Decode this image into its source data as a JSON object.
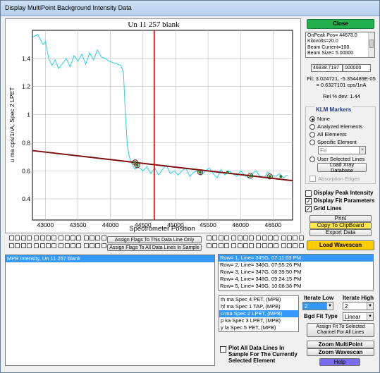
{
  "window": {
    "title": "Display MultiPoint Background Intensity Data"
  },
  "close_button": "Close",
  "info_text": [
    "OnPeak Pos= 44673.0",
    "Kilovolts=20.0",
    "Beam Current=100.",
    "Beam Size= 5.00000"
  ],
  "fields": {
    "value1": "46938.7197",
    "value2": "000000"
  },
  "fit_text": "Fit: 3.024721, -5.354489E-05 = 0.6327101 cps/1nA",
  "rel_dev": "Rel % dev: 1.44",
  "klm": {
    "title": "KLM Markers",
    "options": [
      "None",
      "Analyzed Elements",
      "All Elements",
      "Specific Element"
    ],
    "selected": 0,
    "element_value": "Fe",
    "user_lines": "User Selected Lines",
    "load_xray": "Load Xray Database",
    "absorption": "Absorption Edges"
  },
  "display_opts": [
    {
      "label": "Display Peak Intensity",
      "checked": false
    },
    {
      "label": "Display Fit Parameters",
      "checked": true
    },
    {
      "label": "Grid Lines",
      "checked": true
    }
  ],
  "buttons": {
    "print": "Print",
    "copy": "Copy To ClipBoard",
    "export": "Export Data",
    "load_wavescan": "Load Wavescan",
    "assign_flags_line": "Assign Flags To This Data Line Only",
    "assign_flags_all": "Assign Flags To All Data Lines In Sample",
    "assign_fit": "Assign Fit To Selected Channel For All Lines",
    "zoom_multipoint": "Zoom MultiPoint",
    "zoom_wavescan": "Zoom Wavescan",
    "help": "Help"
  },
  "mpb_list": [
    "MPB Intensity, Un   11  257 blank"
  ],
  "rows_list": [
    "Row= 1, Line=   345G, 07:11:03 PM",
    "Row= 2, Line=   346G, 07:55:26 PM",
    "Row= 3, Line=   347G, 08:39:50 PM",
    "Row= 4, Line=   348G, 09:24:15 PM",
    "Row= 5, Line=   349G, 10:08:38 PM"
  ],
  "spec_list": [
    "th ma Spec  4 PET, (MPB)",
    "hf ma Spec  1 TAP, (MPB)",
    " u ma Spec  2 LPET, (MPB)",
    " p ka Spec  3 LPET, (MPB)",
    " y la Spec  5 PET, (MPB)"
  ],
  "iterate": {
    "low_label": "Iterate Low",
    "high_label": "Iterate High",
    "low": "2",
    "high": "2"
  },
  "bgd_fit": {
    "label": "Bgd Fit Type",
    "value": "Linear"
  },
  "plot_all": "Plot All Data Lines In Sample For The Currently Selected Element",
  "chart_data": {
    "type": "line",
    "title": "Un   11  257 blank",
    "xlabel": "Spectrometer Position",
    "ylabel": "u ma cps/1nA, Spec  2 LPET",
    "xlim": [
      42800,
      46800
    ],
    "ylim": [
      0.25,
      1.6
    ],
    "xticks": [
      43000,
      43500,
      44000,
      44500,
      45000,
      45500,
      46000,
      46500
    ],
    "yticks": [
      0.4,
      0.6,
      0.8,
      1,
      1.2,
      1.4
    ],
    "onpeak_x": 44673,
    "fit_line": {
      "x": [
        42800,
        46800
      ],
      "y": [
        0.744,
        0.53
      ]
    },
    "wavescan_color": "#22d3e6",
    "wavescan": {
      "x": [
        42800,
        42880,
        42960,
        43000,
        43050,
        43100,
        43150,
        43200,
        43260,
        43320,
        43380,
        43440,
        43500,
        43560,
        43620,
        43680,
        43740,
        43800,
        43860,
        43920,
        43980,
        44040,
        44100,
        44160,
        44200,
        44230,
        44260,
        44290,
        44320,
        44350,
        44380,
        44410,
        44450,
        44500,
        44560,
        44620,
        44680,
        44740,
        44800,
        44860,
        44920,
        44980,
        45040,
        45100,
        45160,
        45220,
        45280,
        45340,
        45400,
        45460,
        45520,
        45580,
        45640,
        45700,
        45760,
        45820,
        45880,
        45940,
        46000,
        46060,
        46120,
        46180,
        46240,
        46300,
        46360,
        46420,
        46480,
        46540,
        46600,
        46660,
        46720
      ],
      "y": [
        1.55,
        1.57,
        1.5,
        1.52,
        1.4,
        1.35,
        1.39,
        1.33,
        1.36,
        1.4,
        1.34,
        1.42,
        1.38,
        1.43,
        1.36,
        1.44,
        1.39,
        1.46,
        1.41,
        1.4,
        1.38,
        1.37,
        1.36,
        1.35,
        1.3,
        1.0,
        0.78,
        0.7,
        0.66,
        0.63,
        0.61,
        0.63,
        0.62,
        0.6,
        0.63,
        0.58,
        0.62,
        0.57,
        0.61,
        0.64,
        0.58,
        0.6,
        0.57,
        0.6,
        0.62,
        0.56,
        0.59,
        0.6,
        0.57,
        0.6,
        0.62,
        0.58,
        0.55,
        0.61,
        0.57,
        0.6,
        0.58,
        0.56,
        0.6,
        0.57,
        0.55,
        0.58,
        0.6,
        0.56,
        0.55,
        0.59,
        0.57,
        0.56,
        0.58,
        0.55,
        0.57
      ]
    },
    "points": {
      "x": [
        44380,
        44410,
        45380,
        45800,
        46150,
        46450,
        46620
      ],
      "y": [
        0.66,
        0.64,
        0.59,
        0.59,
        0.565,
        0.56,
        0.56
      ]
    },
    "circled_points": [
      0,
      1,
      2,
      4,
      5
    ]
  }
}
